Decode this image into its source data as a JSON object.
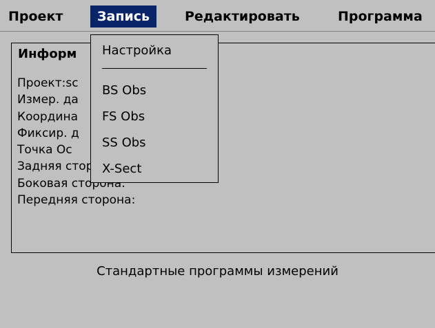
{
  "menubar": {
    "items": [
      "Проект",
      "Запись",
      "Редактировать",
      "Программа"
    ]
  },
  "info_panel": {
    "title": "Информ",
    "rows": [
      "Проект:sc",
      "Измер. да",
      "Координа",
      "Фиксир. д",
      "Точка Ос",
      "Задняя сторона:",
      "Боковая сторона:",
      "Передняя сторона:"
    ]
  },
  "dropdown": {
    "items": [
      "Настройка",
      "BS Obs",
      "FS Obs",
      "SS Obs",
      "X-Sect"
    ]
  },
  "status": {
    "text": "Стандартные программы измерений"
  },
  "colors": {
    "background": "#c0c0c0",
    "selection": "#0a246a"
  }
}
